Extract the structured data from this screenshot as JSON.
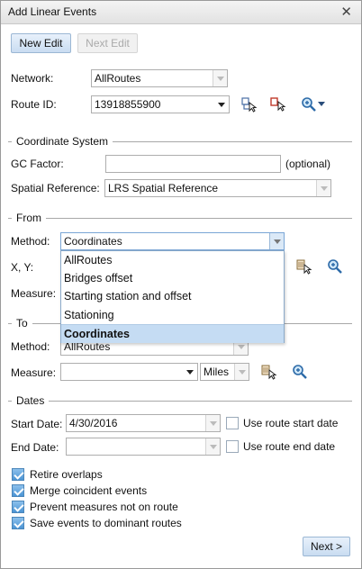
{
  "window": {
    "title": "Add Linear Events"
  },
  "toolbar": {
    "new_edit": "New Edit",
    "next_edit": "Next Edit"
  },
  "network": {
    "label": "Network:",
    "value": "AllRoutes"
  },
  "route": {
    "label": "Route ID:",
    "value": "13918855900"
  },
  "coord": {
    "section": "Coordinate System",
    "gc_label": "GC Factor:",
    "gc_value": "",
    "gc_hint": "(optional)",
    "sr_label": "Spatial Reference:",
    "sr_value": "LRS Spatial Reference"
  },
  "from": {
    "section": "From",
    "method_label": "Method:",
    "method_value": "Coordinates",
    "xy_label": "X, Y:",
    "measure_label": "Measure:",
    "options": [
      "AllRoutes",
      "Bridges offset",
      "Starting station and offset",
      "Stationing",
      "Coordinates"
    ],
    "selected_index": 4
  },
  "to": {
    "section": "To",
    "method_label": "Method:",
    "method_value": "AllRoutes",
    "measure_label": "Measure:",
    "measure_value": "",
    "units_value": "Miles"
  },
  "dates": {
    "section": "Dates",
    "start_label": "Start Date:",
    "start_value": "4/30/2016",
    "use_start": "Use route start date",
    "use_start_checked": false,
    "end_label": "End Date:",
    "end_value": "",
    "use_end": "Use route end date",
    "use_end_checked": false
  },
  "options": [
    {
      "label": "Retire overlaps",
      "checked": true
    },
    {
      "label": "Merge coincident events",
      "checked": true
    },
    {
      "label": "Prevent measures not on route",
      "checked": true
    },
    {
      "label": "Save events to dominant routes",
      "checked": true
    }
  ],
  "footer": {
    "next": "Next >"
  },
  "colors": {
    "accent": "#4b94d4",
    "selected_row": "#c5dcf3"
  }
}
